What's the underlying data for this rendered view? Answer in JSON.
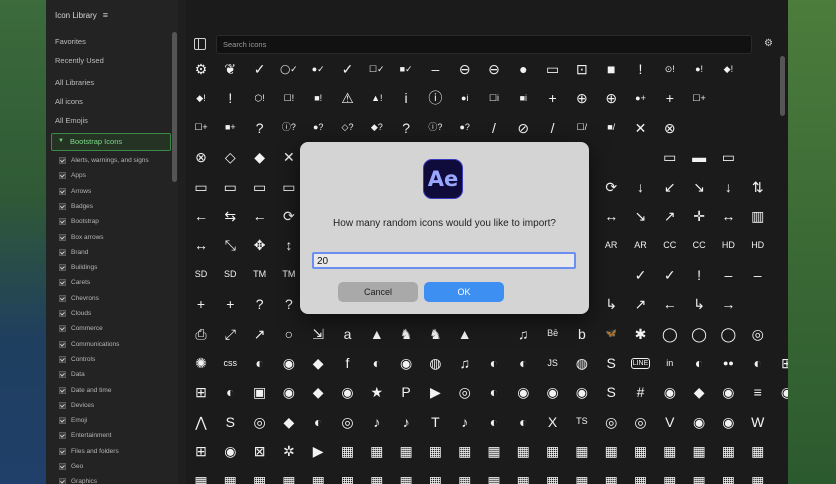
{
  "window": {
    "title": "Icon Library"
  },
  "sidebar": {
    "nav": [
      "Favorites",
      "Recently Used",
      "All Libraries",
      "All icons",
      "All Emojis"
    ],
    "active_library": "Bootstrap Icons",
    "categories": [
      "Alerts, warnings, and signs",
      "Apps",
      "Arrows",
      "Badges",
      "Bootstrap",
      "Box arrows",
      "Brand",
      "Buildings",
      "Carets",
      "Chevrons",
      "Clouds",
      "Commerce",
      "Communications",
      "Controls",
      "Data",
      "Date and time",
      "Devices",
      "Emoji",
      "Entertainment",
      "Files and folders",
      "Geo",
      "Graphics"
    ]
  },
  "search": {
    "placeholder": "Search icons"
  },
  "dialog": {
    "app_icon_text": "Ae",
    "prompt": "How many random icons would you like to import?",
    "value": "20",
    "cancel": "Cancel",
    "ok": "OK"
  },
  "icon_rows": [
    [
      "⚙",
      "❦",
      "✓",
      "◯✓",
      "●✓",
      "✓",
      "☐✓",
      "■✓",
      "–",
      "⊖",
      "⊖",
      "●",
      "▭",
      "⊡",
      "■",
      "!",
      "⊙!",
      "●!",
      "◆!"
    ],
    [
      "◆!",
      "!",
      "⬡!",
      "☐!",
      "■!",
      "⚠",
      "▲!",
      "i",
      "ⓘ",
      "●i",
      "☐i",
      "■i",
      "+",
      "⊕",
      "⊕",
      "●+",
      "+",
      "☐+"
    ],
    [
      "☐+",
      "■+",
      "?",
      "ⓘ?",
      "●?",
      "◇?",
      "◆?",
      "?",
      "ⓘ?",
      "●?",
      "/",
      "⊘",
      "/",
      "☐/",
      "■/",
      "✕",
      "⊗"
    ],
    [
      "⊗",
      "◇",
      "◆",
      "✕",
      "⊗",
      "",
      "",
      "",
      "",
      "",
      "",
      "",
      "",
      "",
      "",
      "",
      "▭",
      "▬",
      "▭"
    ],
    [
      "▭",
      "▭",
      "▭",
      "▭",
      "▭",
      "",
      "",
      "",
      "",
      "",
      "",
      "",
      "",
      "",
      "⟳",
      "↓",
      "↙",
      "↘",
      "↓",
      "⇅"
    ],
    [
      "←",
      "⇆",
      "←",
      "⟳",
      "↩",
      "",
      "",
      "",
      "",
      "",
      "",
      "",
      "",
      "",
      "↔",
      "↘",
      "↗",
      "✛",
      "↔",
      "▥"
    ],
    [
      "↔",
      "⤡",
      "✥",
      "↕",
      "♲",
      "",
      "",
      "",
      "",
      "",
      "",
      "",
      "",
      "",
      "AR",
      "AR",
      "CC",
      "CC",
      "HD",
      "HD"
    ],
    [
      "SD",
      "SD",
      "TM",
      "TM",
      "VO",
      "",
      "",
      "",
      "",
      "",
      "",
      "",
      "",
      "",
      "",
      "✓",
      "✓",
      "!",
      "–",
      "–"
    ],
    [
      "+",
      "+",
      "?",
      "?",
      "B",
      "",
      "",
      "",
      "",
      "",
      "",
      "",
      "",
      "",
      "↳",
      "↗",
      "←",
      "↳",
      "→"
    ],
    [
      "⎙",
      "⤢",
      "↗",
      "○",
      "⇲",
      "a",
      "▲",
      "♞",
      "♞",
      "▲",
      "",
      "♫",
      "Bē",
      "b",
      "🦋",
      "✱",
      "◯",
      "◯",
      "◯",
      "◎"
    ],
    [
      "✺",
      "css",
      "◐",
      "◉",
      "◆",
      "f",
      "◐",
      "◉",
      "◍",
      "♫",
      "◐",
      "◐",
      "JS",
      "◍",
      "S",
      "LINE",
      "in",
      "◐",
      "●●",
      "◐",
      "⊞"
    ],
    [
      "⊞",
      "◐",
      "▣",
      "◉",
      "◆",
      "◉",
      "★",
      "P",
      "▶",
      "◎",
      "◐",
      "◉",
      "◉",
      "◉",
      "S",
      "#",
      "◉",
      "◆",
      "◉",
      "≡",
      "◉"
    ],
    [
      "⋀",
      "S",
      "◎",
      "◆",
      "◐",
      "◎",
      "♪",
      "♪",
      "T",
      "♪",
      "◐",
      "◐",
      "X",
      "TS",
      "◎",
      "◎",
      "V",
      "◉",
      "◉",
      "W"
    ],
    [
      "⊞",
      "◉",
      "⊠",
      "✲",
      "▶",
      "▦",
      "▦",
      "▦",
      "▦",
      "▦",
      "▦",
      "▦",
      "▦",
      "▦",
      "▦",
      "▦",
      "▦",
      "▦",
      "▦",
      "▦"
    ],
    [
      "▦",
      "▦",
      "▦",
      "▦",
      "▦",
      "▦",
      "▦",
      "▦",
      "▦",
      "▦",
      "▦",
      "▦",
      "▦",
      "▦",
      "▦",
      "▦",
      "▦",
      "▦",
      "▦",
      "▦"
    ]
  ]
}
